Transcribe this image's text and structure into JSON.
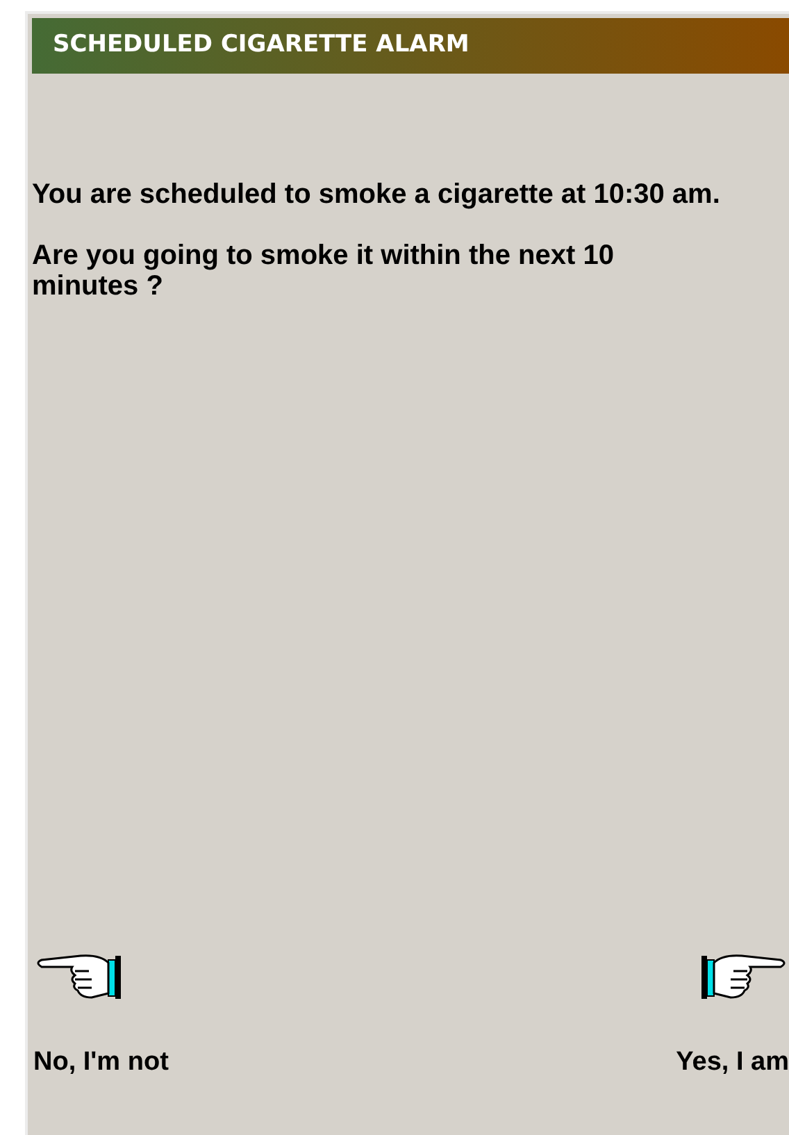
{
  "title": "SCHEDULED CIGARETTE ALARM",
  "messages": [
    "You are scheduled to smoke a cigarette at 10:30 am.",
    "Are you going to smoke it within the next 10 minutes ?"
  ],
  "choices": [
    {
      "label": "No, I'm not",
      "kind": "left"
    },
    {
      "label": "Yes, I am",
      "kind": "right"
    }
  ]
}
